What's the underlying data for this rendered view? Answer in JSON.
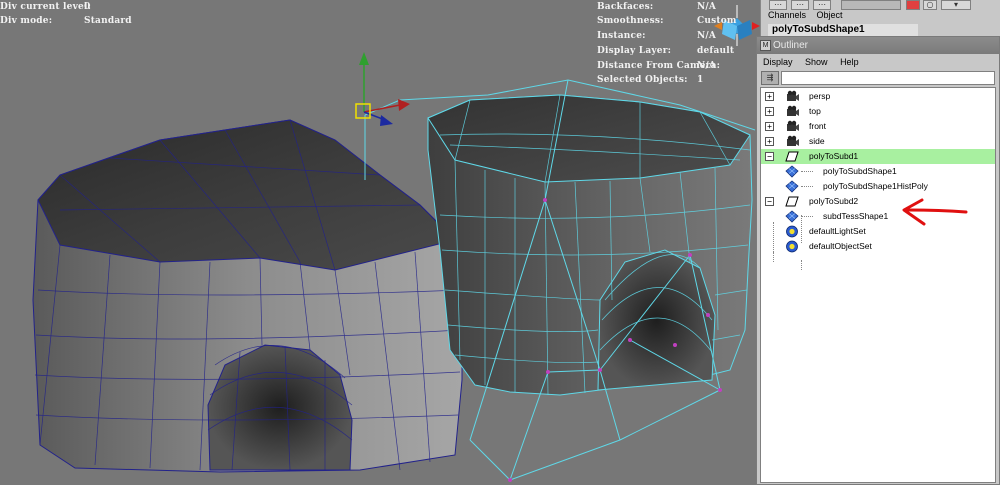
{
  "hud_left": [
    {
      "label": "Div current level:",
      "value": "0"
    },
    {
      "label": "Div mode:",
      "value": "Standard"
    }
  ],
  "hud_right": [
    {
      "label": "Backfaces:",
      "value": "N/A"
    },
    {
      "label": "Smoothness:",
      "value": "Custom"
    },
    {
      "label": "Instance:",
      "value": "N/A"
    },
    {
      "label": "Display Layer:",
      "value": "default"
    },
    {
      "label": "Distance From Camera:",
      "value": "N/A"
    },
    {
      "label": "Selected Objects:",
      "value": "1"
    }
  ],
  "channel_box": {
    "menu": [
      "Channels",
      "Object"
    ],
    "title": "polyToSubdShape1"
  },
  "outliner": {
    "title": "Outliner",
    "menu": [
      "Display",
      "Show",
      "Help"
    ],
    "filter_value": "",
    "rows": [
      {
        "label": "persp",
        "icon": "camera-icon",
        "expander": "+"
      },
      {
        "label": "top",
        "icon": "camera-icon",
        "expander": "+"
      },
      {
        "label": "front",
        "icon": "camera-icon",
        "expander": "+"
      },
      {
        "label": "side",
        "icon": "camera-icon",
        "expander": "+"
      },
      {
        "label": "polyToSubd1",
        "icon": "transform-icon",
        "expander": "−",
        "selected": true
      },
      {
        "label": "polyToSubdShape1",
        "icon": "mesh-icon",
        "expander": ""
      },
      {
        "label": "polyToSubdShape1HistPoly",
        "icon": "mesh-icon",
        "expander": ""
      },
      {
        "label": "polyToSubd2",
        "icon": "transform-icon",
        "expander": "−"
      },
      {
        "label": "subdTessShape1",
        "icon": "mesh-icon",
        "expander": ""
      },
      {
        "label": "defaultLightSet",
        "icon": "set-icon",
        "expander": ""
      },
      {
        "label": "defaultObjectSet",
        "icon": "set-icon",
        "expander": ""
      }
    ]
  },
  "colors": {
    "viewport_bg": "#777777",
    "wire_cyan": "#5fd8e8",
    "wire_blue": "#22228a",
    "selected_row": "#a8f0a0",
    "annotation_red": "#e01010"
  }
}
